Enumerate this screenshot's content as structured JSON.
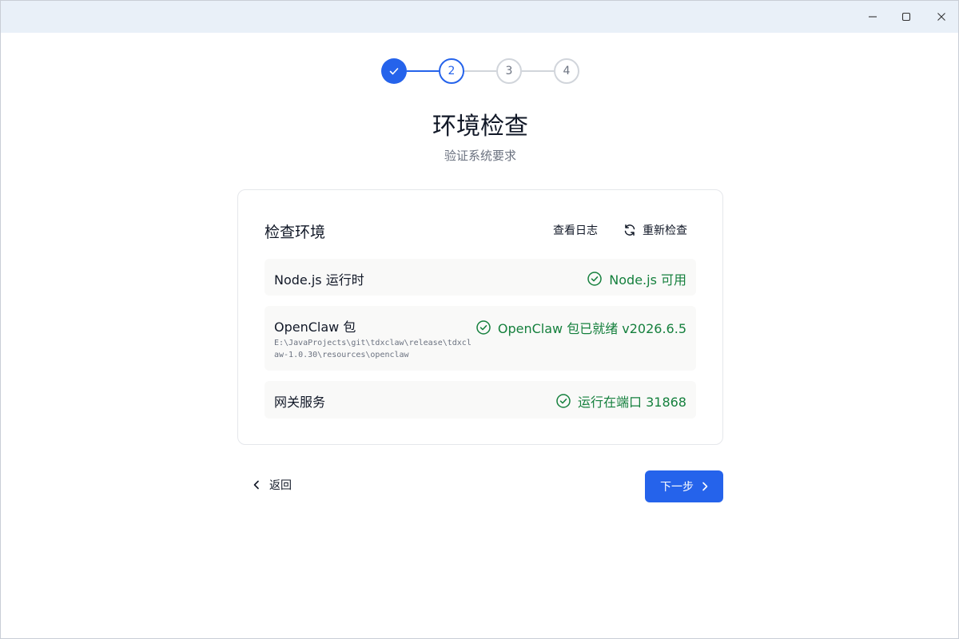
{
  "stepper": {
    "steps": [
      {
        "label": "",
        "state": "done"
      },
      {
        "label": "2",
        "state": "active"
      },
      {
        "label": "3",
        "state": "todo"
      },
      {
        "label": "4",
        "state": "todo"
      }
    ]
  },
  "header": {
    "title": "环境检查",
    "subtitle": "验证系统要求"
  },
  "card": {
    "title": "检查环境",
    "view_log_label": "查看日志",
    "recheck_label": "重新检查",
    "items": [
      {
        "name": "Node.js 运行时",
        "status": "Node.js 可用",
        "path": ""
      },
      {
        "name": "OpenClaw 包",
        "status": "OpenClaw 包已就绪 v2026.6.5",
        "path": "E:\\JavaProjects\\git\\tdxclaw\\release\\tdxclaw-1.0.30\\resources\\openclaw"
      },
      {
        "name": "网关服务",
        "status": "运行在端口 31868",
        "path": ""
      }
    ]
  },
  "footer": {
    "back_label": "返回",
    "next_label": "下一步"
  },
  "colors": {
    "accent": "#2563eb",
    "success": "#15803d",
    "titlebar": "#e9f0f8"
  }
}
